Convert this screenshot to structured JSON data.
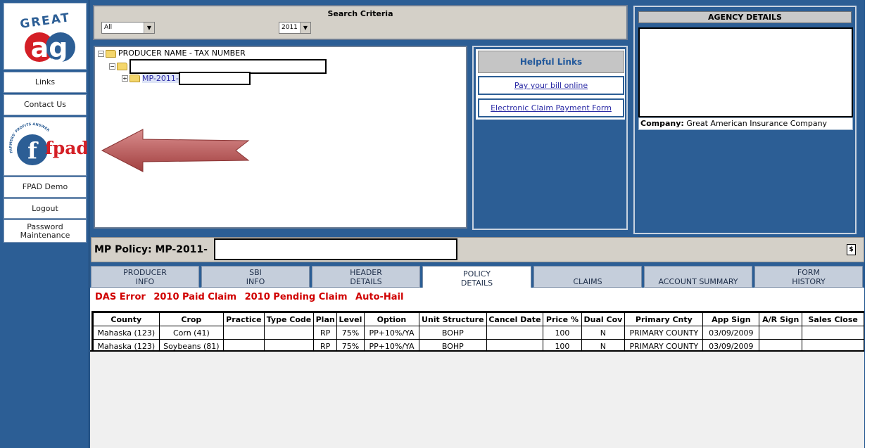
{
  "sidebar": {
    "logo_top_text": "GREAT",
    "logo_main_text": "ag",
    "fpad_ring_text": "FARMERS' PROFITS ANSWERED DAILY",
    "fpad_text": "fpad",
    "items": [
      {
        "label": "Links"
      },
      {
        "label": "Contact Us"
      },
      {
        "label": "FPAD Demo"
      },
      {
        "label": "Logout"
      },
      {
        "label": "Password Maintenance"
      }
    ]
  },
  "search": {
    "title": "Search Criteria",
    "filter_value": "All",
    "year_value": "2011"
  },
  "tree": {
    "root_label": "PRODUCER NAME - TAX NUMBER",
    "policy_node_label": "MP-2011-"
  },
  "helpful_links": {
    "title": "Helpful Links",
    "links": [
      {
        "label": "Pay your bill online "
      },
      {
        "label": "Electronic Claim Payment Form "
      }
    ]
  },
  "agency": {
    "title": "AGENCY DETAILS",
    "company_label": "Company:",
    "company_value": "Great American Insurance Company"
  },
  "policy_bar": {
    "label": "MP Policy: MP-2011-"
  },
  "tabs": [
    {
      "line1": "PRODUCER",
      "line2": "INFO",
      "active": false
    },
    {
      "line1": "SBI",
      "line2": "INFO",
      "active": false
    },
    {
      "line1": "HEADER",
      "line2": "DETAILS",
      "active": false
    },
    {
      "line1": "POLICY",
      "line2": "DETAILS",
      "active": true
    },
    {
      "line1": "",
      "line2": "CLAIMS",
      "active": false
    },
    {
      "line1": "",
      "line2": "ACCOUNT SUMMARY",
      "active": false
    },
    {
      "line1": "FORM",
      "line2": "HISTORY",
      "active": false
    }
  ],
  "alerts": [
    "DAS Error",
    "2010 Paid Claim",
    "2010 Pending Claim",
    "Auto-Hail"
  ],
  "table": {
    "columns": [
      "County",
      "Crop",
      "Practice",
      "Type Code",
      "Plan",
      "Level",
      "Option",
      "Unit Structure",
      "Cancel Date",
      "Price %",
      "Dual Cov",
      "Primary Cnty",
      "App Sign",
      "A/R Sign",
      "Sales Close"
    ],
    "rows": [
      [
        "Mahaska (123)",
        "Corn (41)",
        "",
        "",
        "RP",
        "75%",
        "PP+10%/YA",
        "BOHP",
        "",
        "100",
        "N",
        "PRIMARY COUNTY",
        "03/09/2009",
        "",
        ""
      ],
      [
        "Mahaska (123)",
        "Soybeans (81)",
        "",
        "",
        "RP",
        "75%",
        "PP+10%/YA",
        "BOHP",
        "",
        "100",
        "N",
        "PRIMARY COUNTY",
        "03/09/2009",
        "",
        ""
      ]
    ]
  },
  "colors": {
    "frame_blue": "#2c5e95",
    "alert_red": "#d00000",
    "arrow_red": "#b85c5c"
  }
}
